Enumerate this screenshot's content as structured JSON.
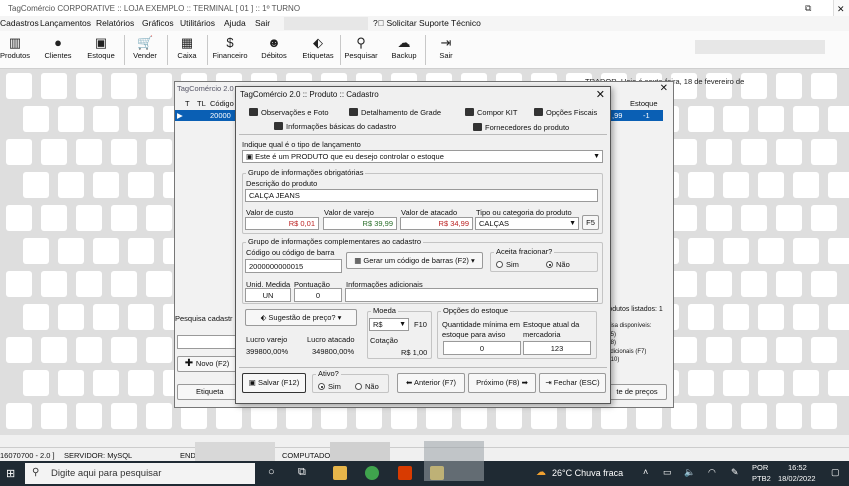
{
  "window": {
    "title": "TagComércio CORPORATIVE :: LOJA EXEMPLO :: TERMINAL [ 01 ] :: 1º TURNO",
    "restore_glyph": "⧉",
    "close_glyph": "✕"
  },
  "menu": [
    "Cadastros",
    "Lançamentos",
    "Relatórios",
    "Gráficos",
    "Utilitários",
    "Ajuda",
    "Sair",
    "Solicitar Suporte Técnico"
  ],
  "toolbar": [
    "Produtos",
    "Clientes",
    "Estoque",
    "Vender",
    "Caixa",
    "Financeiro",
    "Débitos",
    "Etiquetas",
    "Pesquisar",
    "Backup",
    "Sair"
  ],
  "greeting": "TRADOR, Hoje é sexta-feira, 18 de fevereiro de",
  "list_window": {
    "title": "TagComércio 2.0",
    "headers": [
      "T",
      "TL",
      "Código",
      "Estoque"
    ],
    "selected_code": "20000",
    "selected_tail": ",99",
    "selected_stock": "-1",
    "products_listed": "rodutos listados: 1",
    "search_label": "Pesquisa cadastr",
    "new_button": "Novo (F2)",
    "etiq_button": "Etiqueta",
    "prices_button": "te de preços",
    "side_text": [
      "uisa disponíveis:",
      "F5)",
      "F8)",
      "adicionais (F7)",
      "F10)"
    ]
  },
  "dialog": {
    "title": "TagComércio 2.0 :: Produto :: Cadastro",
    "tabs_top": [
      "Observações e Foto",
      "Detalhamento de Grade",
      "Compor KIT",
      "Opções Fiscais"
    ],
    "tabs_bottom": [
      "Informações básicas do cadastro",
      "Fornecedores do produto"
    ],
    "type_label": "Indique qual é o tipo de lançamento",
    "type_value": "Este é um PRODUTO que eu desejo controlar o estoque",
    "group_required": "Grupo de informações obrigatórias",
    "desc_label": "Descrição do produto",
    "desc_value": "CALÇA JEANS",
    "cost_label": "Valor de custo",
    "cost_value": "R$ 0,01",
    "retail_label": "Valor de varejo",
    "retail_value": "R$ 39,99",
    "wholesale_label": "Valor de atacado",
    "wholesale_value": "R$ 34,99",
    "category_label": "Tipo ou categoria do produto",
    "category_value": "CALÇAS",
    "f5": "F5",
    "group_extra": "Grupo de informações complementares ao cadastro",
    "barcode_label": "Código ou código de barra",
    "barcode_value": "2000000000015",
    "gen_barcode": "Gerar um código de barras (F2)",
    "fraction_label": "Aceita fracionar?",
    "fraction_yes": "Sim",
    "fraction_no": "Não",
    "unit_label": "Unid. Medida",
    "unit_value": "UN",
    "points_label": "Pontuação",
    "points_value": "0",
    "addinfo_label": "Informações adicionais",
    "suggest_button": "Sugestão de preço?",
    "profit_retail_label": "Lucro varejo",
    "profit_retail_value": "399800,00%",
    "profit_whole_label": "Lucro atacado",
    "profit_whole_value": "349800,00%",
    "currency_label": "Moeda",
    "currency_value": "R$",
    "f10": "F10",
    "quote_label": "Cotação",
    "quote_value": "R$ 1,00",
    "stock_opts": "Opções do estoque",
    "min_qty_label": "Quantidade mínima em estoque para aviso",
    "min_qty_value": "0",
    "cur_stock_label": "Estoque atual da mercadoria",
    "cur_stock_value": "123",
    "save_button": "Salvar (F12)",
    "active_label": "Ativo?",
    "active_yes": "Sim",
    "active_no": "Não",
    "prev_button": "Anterior (F7)",
    "next_button": "Próximo (F8)",
    "close_button": "Fechar (ESC)"
  },
  "statusbar": {
    "code": "16070700 - 2.0 ]",
    "server": "SERVIDOR: MySQL",
    "end": "END",
    "computer": "COMPUTADO"
  },
  "taskbar": {
    "search_placeholder": "Digite aqui para pesquisar",
    "weather": "26°C Chuva fraca",
    "lang": "POR",
    "layout": "PTB2",
    "time": "16:52",
    "date": "18/02/2022"
  }
}
